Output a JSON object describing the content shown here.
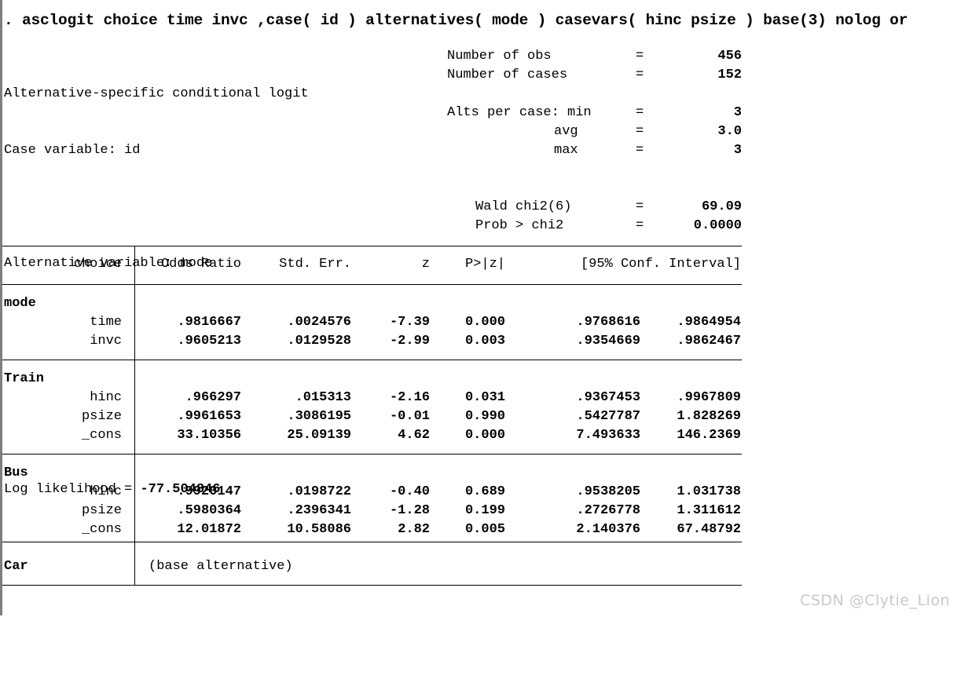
{
  "command": ". asclogit choice time invc ,case( id ) alternatives( mode ) casevars( hinc psize ) base(3) nolog or",
  "header": {
    "left": [
      {
        "text": "Alternative-specific conditional logit",
        "bold": false
      },
      {
        "text": "Case variable: id",
        "bold": false
      },
      {
        "text": "",
        "bold": false
      },
      {
        "text": "Alternative variable: mode",
        "bold": false
      }
    ],
    "log_likelihood_label": "Log likelihood = ",
    "log_likelihood_value": "-77.504846",
    "right": [
      {
        "label": "Number of obs",
        "eq": "=",
        "value": "456"
      },
      {
        "label": "Number of cases",
        "eq": "=",
        "value": "152"
      },
      {
        "label": "Alts per case: min",
        "eq": "=",
        "value": "3"
      },
      {
        "label": "avg",
        "eq": "=",
        "value": "3.0"
      },
      {
        "label": "max",
        "eq": "=",
        "value": "3"
      },
      {
        "label": "Wald chi2(6)",
        "eq": "=",
        "value": "69.09"
      },
      {
        "label": "Prob > chi2",
        "eq": "=",
        "value": "0.0000"
      }
    ]
  },
  "table": {
    "columns": {
      "rowlabel": "choice",
      "odds_ratio": "Odds Ratio",
      "std_err": "Std. Err.",
      "z": "z",
      "p": "P>|z|",
      "ci": "[95% Conf. Interval]"
    },
    "groups": [
      {
        "name": "mode",
        "rows": [
          {
            "label": "time",
            "odds_ratio": ".9816667",
            "std_err": ".0024576",
            "z": "-7.39",
            "p": "0.000",
            "ci_low": ".9768616",
            "ci_high": ".9864954"
          },
          {
            "label": "invc",
            "odds_ratio": ".9605213",
            "std_err": ".0129528",
            "z": "-2.99",
            "p": "0.003",
            "ci_low": ".9354669",
            "ci_high": ".9862467"
          }
        ]
      },
      {
        "name": "Train",
        "rows": [
          {
            "label": "hinc",
            "odds_ratio": ".966297",
            "std_err": ".015313",
            "z": "-2.16",
            "p": "0.031",
            "ci_low": ".9367453",
            "ci_high": ".9967809"
          },
          {
            "label": "psize",
            "odds_ratio": ".9961653",
            "std_err": ".3086195",
            "z": "-0.01",
            "p": "0.990",
            "ci_low": ".5427787",
            "ci_high": "1.828269"
          },
          {
            "label": "_cons",
            "odds_ratio": "33.10356",
            "std_err": "25.09139",
            "z": "4.62",
            "p": "0.000",
            "ci_low": "7.493633",
            "ci_high": "146.2369"
          }
        ]
      },
      {
        "name": "Bus",
        "rows": [
          {
            "label": "hinc",
            "odds_ratio": ".9920147",
            "std_err": ".0198722",
            "z": "-0.40",
            "p": "0.689",
            "ci_low": ".9538205",
            "ci_high": "1.031738"
          },
          {
            "label": "psize",
            "odds_ratio": ".5980364",
            "std_err": ".2396341",
            "z": "-1.28",
            "p": "0.199",
            "ci_low": ".2726778",
            "ci_high": "1.311612"
          },
          {
            "label": "_cons",
            "odds_ratio": "12.01872",
            "std_err": "10.58086",
            "z": "2.82",
            "p": "0.005",
            "ci_low": "2.140376",
            "ci_high": "67.48792"
          }
        ]
      },
      {
        "name": "Car",
        "note": "(base alternative)",
        "rows": []
      }
    ]
  },
  "watermark": "CSDN @Clytie_Lion",
  "colors": {
    "text": "#000000",
    "background": "#ffffff",
    "left_edge": "#7f7f7f",
    "watermark": "#c9c9c9"
  }
}
